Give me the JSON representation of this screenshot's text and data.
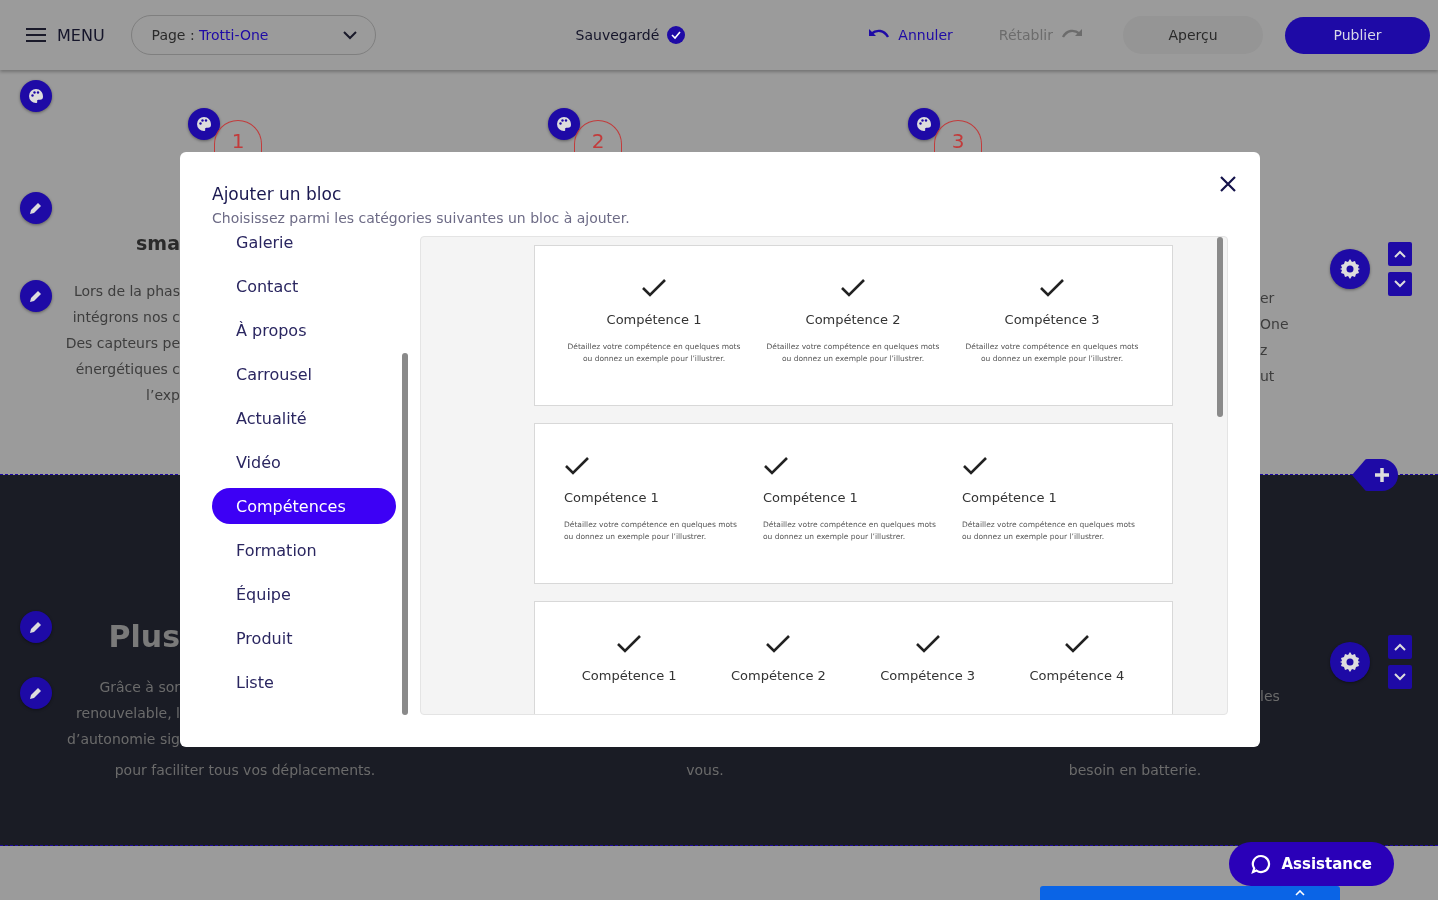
{
  "header": {
    "menu_label": "MENU",
    "page_selector": {
      "label": "Page :",
      "value": "Trotti-One"
    },
    "save_status": "Sauvegardé",
    "undo": {
      "label": "Annuler",
      "disabled": false
    },
    "redo": {
      "label": "Rétablir",
      "disabled": true
    },
    "preview": "Aperçu",
    "publish": "Publier"
  },
  "background": {
    "step_numbers": [
      "1",
      "2",
      "3"
    ],
    "top_section": {
      "left_heading": "sma",
      "left_lines": [
        "Lors de la phas",
        "intégrons nos c",
        "Des capteurs pe",
        "énergétiques c",
        "l’exp"
      ],
      "right_lines": [
        "er",
        "One",
        "z",
        "ut"
      ]
    },
    "dark_section": {
      "left_heading": "Plus",
      "left_lines": [
        "Grâce à sor",
        "renouvelable, l",
        "d’autonomie sig"
      ],
      "right_lines": [
        "les"
      ],
      "columns": [
        {
          "lines": [
            "pour faciliter tous vos déplacements."
          ]
        },
        {
          "lines": [
            "vous."
          ]
        },
        {
          "lines": [
            "besoin en batterie."
          ]
        }
      ]
    }
  },
  "modal": {
    "title": "Ajouter un bloc",
    "subtitle": "Choisissez parmi les catégories suivantes un bloc à ajouter.",
    "categories": [
      {
        "label": "Galerie",
        "selected": false
      },
      {
        "label": "Contact",
        "selected": false
      },
      {
        "label": "À propos",
        "selected": false
      },
      {
        "label": "Carrousel",
        "selected": false
      },
      {
        "label": "Actualité",
        "selected": false
      },
      {
        "label": "Vidéo",
        "selected": false
      },
      {
        "label": "Compétences",
        "selected": true
      },
      {
        "label": "Formation",
        "selected": false
      },
      {
        "label": "Équipe",
        "selected": false
      },
      {
        "label": "Produit",
        "selected": false
      },
      {
        "label": "Liste",
        "selected": false
      }
    ],
    "previews": [
      {
        "kind": "centered",
        "items": [
          {
            "title": "Compétence 1",
            "description": "Détaillez votre compétence en quelques mots ou donnez un exemple pour l’illustrer."
          },
          {
            "title": "Compétence 2",
            "description": "Détaillez votre compétence en quelques mots ou donnez un exemple pour l’illustrer."
          },
          {
            "title": "Compétence 3",
            "description": "Détaillez votre compétence en quelques mots ou donnez un exemple pour l’illustrer."
          }
        ]
      },
      {
        "kind": "left",
        "items": [
          {
            "title": "Compétence 1",
            "description": "Détaillez votre compétence en quelques mots ou donnez un exemple pour l’illustrer."
          },
          {
            "title": "Compétence 1",
            "description": "Détaillez votre compétence en quelques mots ou donnez un exemple pour l’illustrer."
          },
          {
            "title": "Compétence 1",
            "description": "Détaillez votre compétence en quelques mots ou donnez un exemple pour l’illustrer."
          }
        ]
      },
      {
        "kind": "centered",
        "items": [
          {
            "title": "Compétence 1"
          },
          {
            "title": "Compétence 2"
          },
          {
            "title": "Compétence 3"
          },
          {
            "title": "Compétence 4"
          }
        ]
      }
    ]
  },
  "assistance": "Assistance"
}
